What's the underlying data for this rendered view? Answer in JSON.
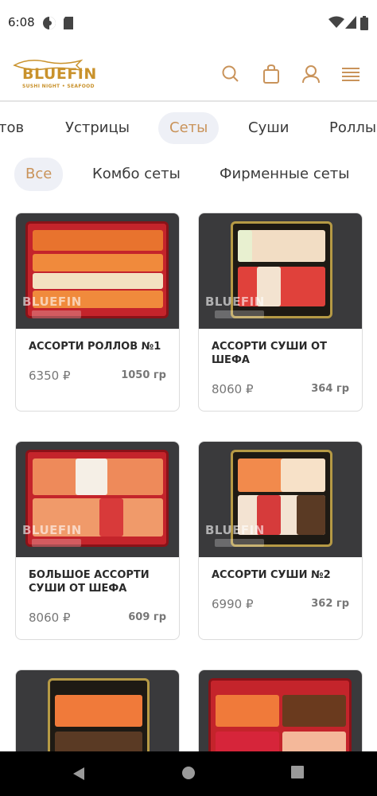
{
  "status": {
    "time": "6:08"
  },
  "header": {
    "logo_text": "BLUEFIN",
    "logo_sub": "SUSHI NIGHT • SEAFOOD",
    "icons": [
      "search-icon",
      "bag-icon",
      "user-icon",
      "menu-icon"
    ]
  },
  "categories": [
    {
      "label": "тов",
      "active": false
    },
    {
      "label": "Устрицы",
      "active": false
    },
    {
      "label": "Сеты",
      "active": true
    },
    {
      "label": "Суши",
      "active": false
    },
    {
      "label": "Роллы",
      "active": false
    }
  ],
  "subcategories": [
    {
      "label": "Все",
      "active": true
    },
    {
      "label": "Комбо сеты",
      "active": false
    },
    {
      "label": "Фирменные сеты",
      "active": false
    }
  ],
  "watermark": "BLUEFIN",
  "products": [
    {
      "name": "Ассорти роллов №1",
      "price": "6350 ₽",
      "weight": "1050 гр"
    },
    {
      "name": "Ассорти суши от шефа",
      "price": "8060 ₽",
      "weight": "364 гр"
    },
    {
      "name": "Большое ассорти суши от шефа",
      "price": "8060 ₽",
      "weight": "609 гр"
    },
    {
      "name": "Ассорти суши №2",
      "price": "6990 ₽",
      "weight": "362 гр"
    },
    {
      "name": "",
      "price": "",
      "weight": ""
    },
    {
      "name": "",
      "price": "",
      "weight": ""
    }
  ],
  "colors": {
    "accent": "#c9935a",
    "tab_bg": "#eef0f6",
    "card_border": "#dcdcdc"
  }
}
